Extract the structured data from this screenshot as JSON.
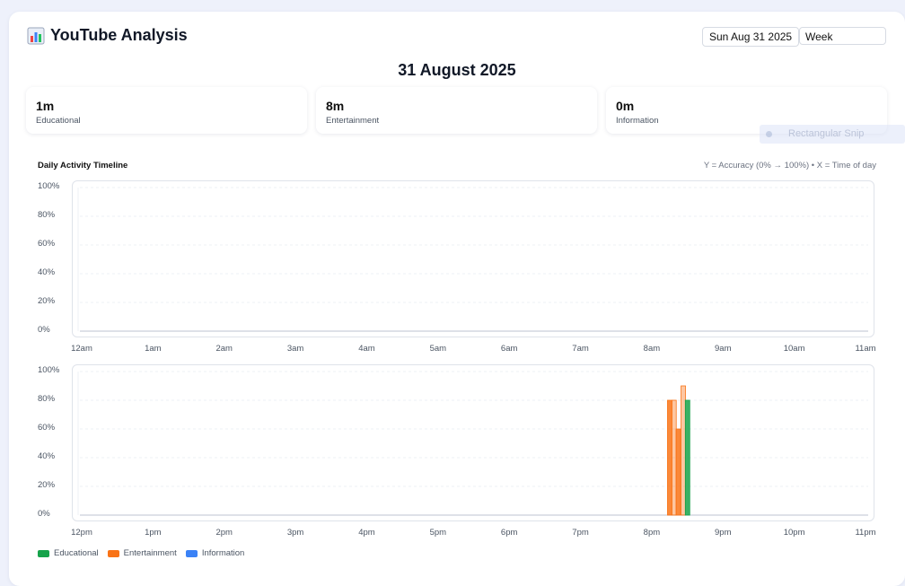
{
  "header": {
    "title": "YouTube Analysis",
    "date_button": "Sun Aug 31 2025",
    "range_value": "Week"
  },
  "page_date": "31 August 2025",
  "stats": [
    {
      "value": "1m",
      "label": "Educational"
    },
    {
      "value": "8m",
      "label": "Entertainment"
    },
    {
      "value": "0m",
      "label": "Information"
    }
  ],
  "overlay": {
    "snip_text": "Rectangular Snip"
  },
  "timeline": {
    "title": "Daily Activity Timeline",
    "axis_note": "Y = Accuracy (0% → 100%) • X = Time of day"
  },
  "colors": {
    "Educational": "#16a34a",
    "Entertainment": "#f97316",
    "Information": "#3b82f6"
  },
  "chart_data": [
    {
      "type": "bar",
      "x_unit": "hour",
      "xlim": [
        0,
        11
      ],
      "x_ticks": [
        "12am",
        "1am",
        "2am",
        "3am",
        "4am",
        "5am",
        "6am",
        "7am",
        "8am",
        "9am",
        "10am",
        "11am"
      ],
      "y_ticks": [
        "100%",
        "80%",
        "60%",
        "40%",
        "20%",
        "0%"
      ],
      "ylim": [
        0,
        100
      ],
      "grid": true,
      "series": []
    },
    {
      "type": "bar",
      "x_unit": "hour",
      "xlim": [
        12,
        23
      ],
      "x_ticks": [
        "12pm",
        "1pm",
        "2pm",
        "3pm",
        "4pm",
        "5pm",
        "6pm",
        "7pm",
        "8pm",
        "9pm",
        "10pm",
        "11pm"
      ],
      "y_ticks": [
        "100%",
        "80%",
        "60%",
        "40%",
        "20%",
        "0%"
      ],
      "ylim": [
        0,
        100
      ],
      "grid": true,
      "series": [
        {
          "name": "Entertainment",
          "points": [
            {
              "x": 20.24,
              "y": 80
            },
            {
              "x": 20.3,
              "y": 80
            },
            {
              "x": 20.36,
              "y": 60
            },
            {
              "x": 20.43,
              "y": 90
            }
          ]
        },
        {
          "name": "Educational",
          "points": [
            {
              "x": 20.49,
              "y": 80
            }
          ]
        }
      ]
    }
  ],
  "legend": [
    "Educational",
    "Entertainment",
    "Information"
  ]
}
